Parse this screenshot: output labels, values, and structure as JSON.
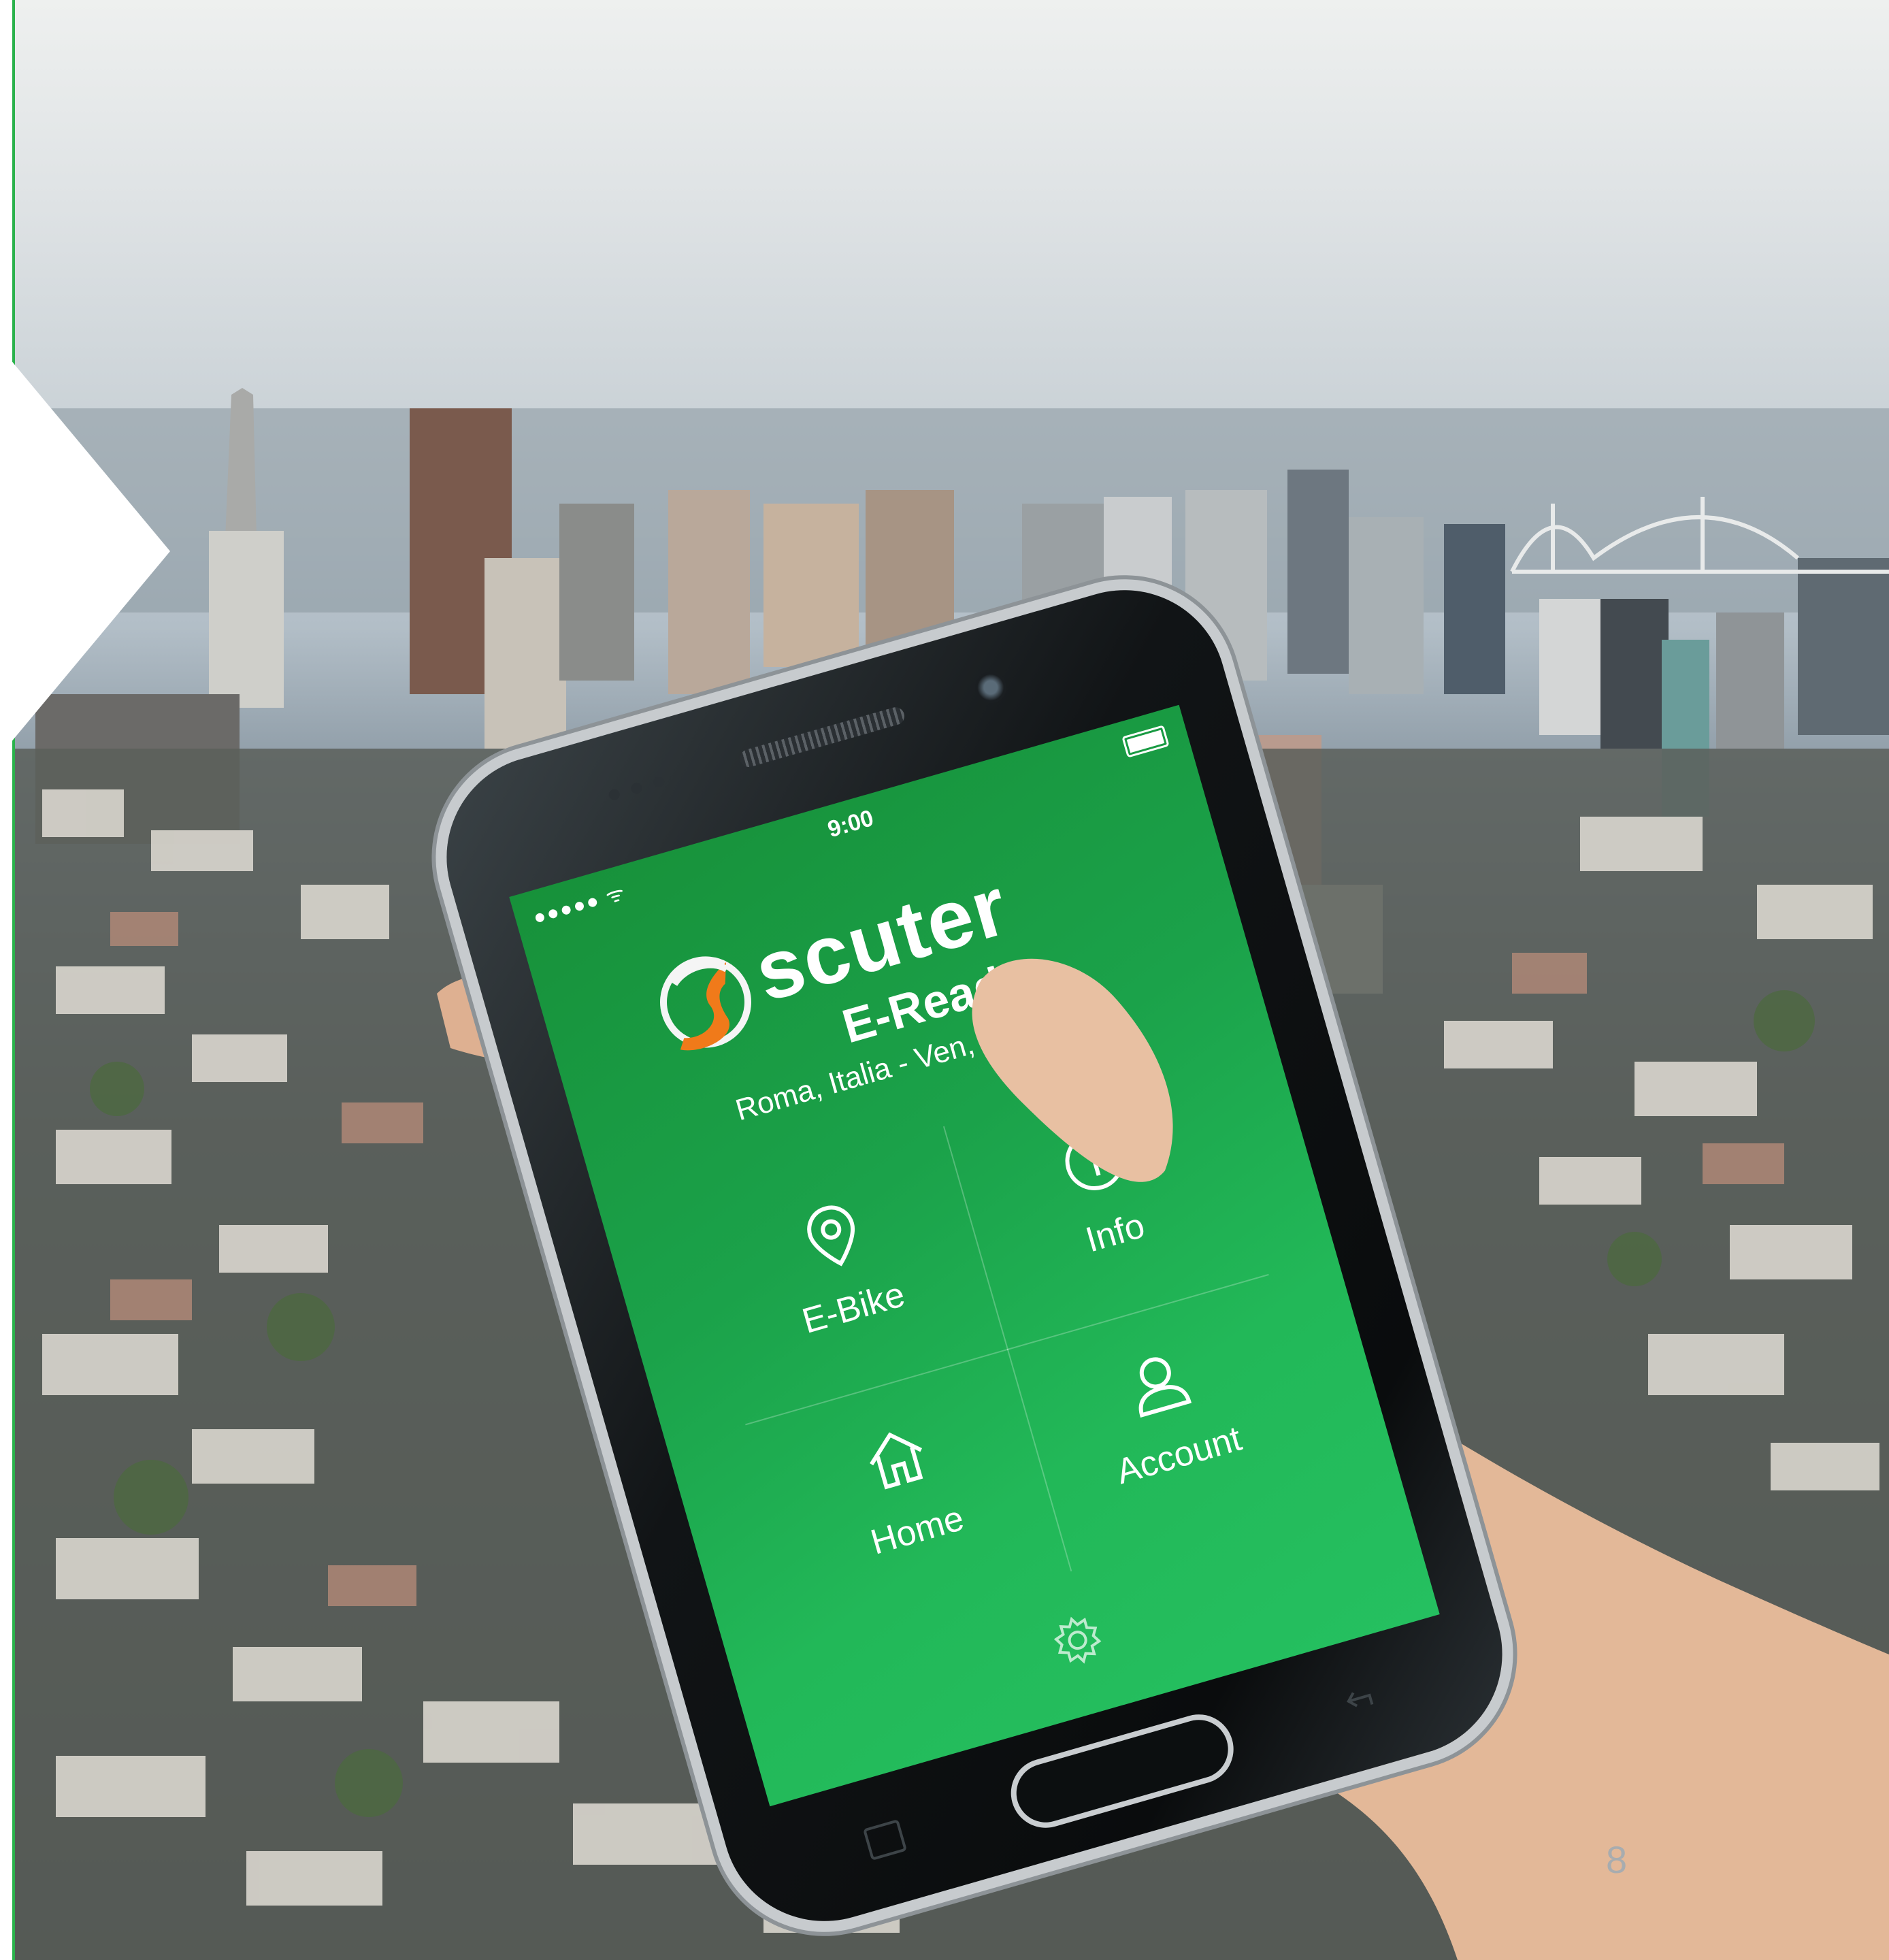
{
  "slide": {
    "page_number": "8",
    "accent_color": "#2bb24c"
  },
  "phone": {
    "status_bar": {
      "signal": "●●●●● ᯤ",
      "time": "9:00",
      "battery_level": 1.0
    },
    "app": {
      "brand": "scuter",
      "subtitle": "E-Ready",
      "location_date": "Roma, Italia - Ven, 6 Maggio",
      "screen_color": "#1ea94f",
      "menu": [
        {
          "label": "E-Bike",
          "icon": "location-pin-icon"
        },
        {
          "label": "Info",
          "icon": "info-icon"
        },
        {
          "label": "Home",
          "icon": "home-icon"
        },
        {
          "label": "Account",
          "icon": "user-icon"
        }
      ],
      "settings_icon": "gear-icon"
    }
  }
}
